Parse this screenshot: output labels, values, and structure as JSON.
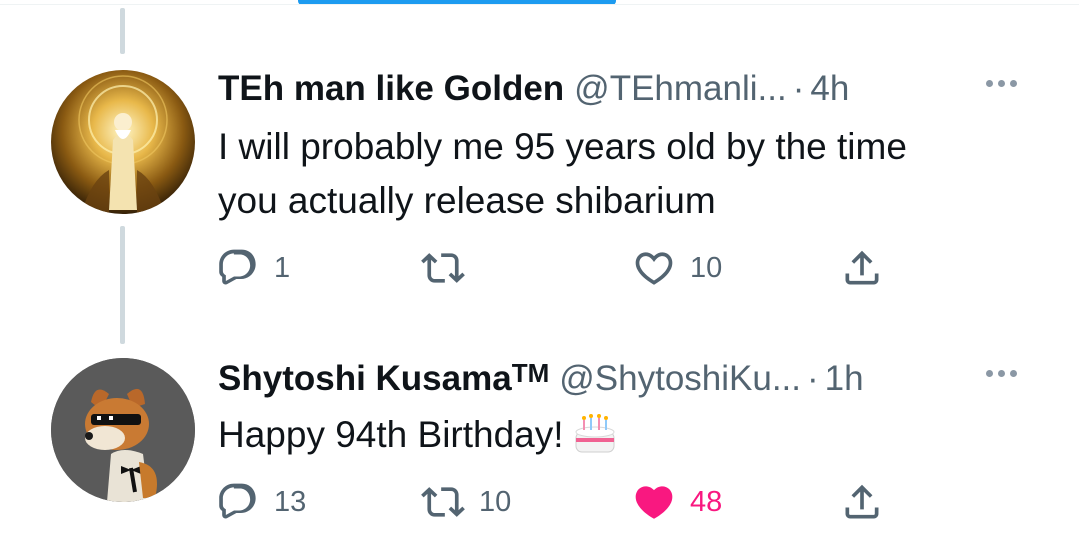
{
  "colors": {
    "accent": "#1d9bf0",
    "like": "#f91880",
    "muted": "#536471",
    "text": "#0f1419"
  },
  "tweets": [
    {
      "name": "TEh man like Golden",
      "name_suffix": "",
      "handle": "@TEhmanli...",
      "separator": "·",
      "time": "4h",
      "lines": [
        "I will probably me 95 years old by the time",
        "you actually release shibarium"
      ],
      "emoji": "",
      "reply_count": "1",
      "retweet_count": "",
      "like_count": "10",
      "liked": false,
      "avatar_icon": "golden-figure-avatar"
    },
    {
      "name": "Shytoshi Kusama",
      "name_suffix": "TM",
      "handle": "@ShytoshiKu...",
      "separator": "·",
      "time": "1h",
      "lines": [
        "Happy 94th Birthday!"
      ],
      "emoji": "birthday-cake-icon",
      "reply_count": "13",
      "retweet_count": "10",
      "like_count": "48",
      "liked": true,
      "avatar_icon": "shiba-sunglasses-avatar"
    }
  ]
}
